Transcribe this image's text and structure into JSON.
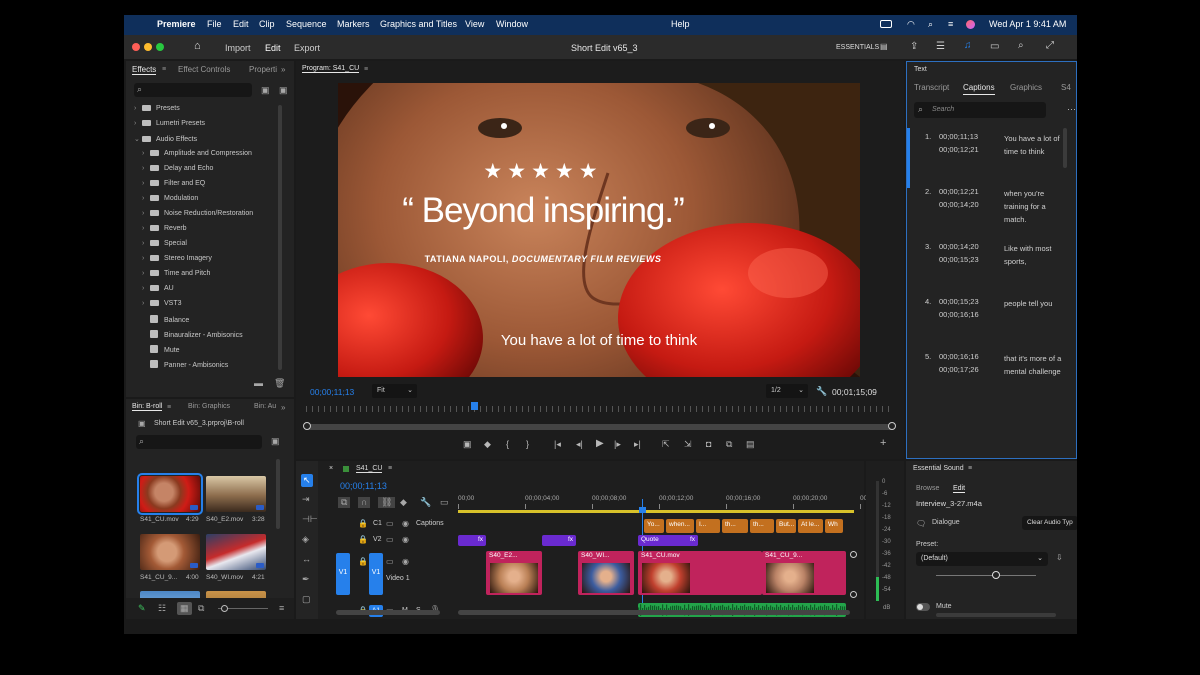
{
  "menubar": {
    "app": "Premiere",
    "items": [
      "File",
      "Edit",
      "Clip",
      "Sequence",
      "Markers",
      "Graphics and Titles",
      "View",
      "Window"
    ],
    "help": "Help",
    "clock": "Wed Apr 1  9:41 AM"
  },
  "titlebar": {
    "nav": [
      "Import",
      "Edit",
      "Export"
    ],
    "active_nav": "Edit",
    "title": "Short Edit v65_3",
    "workspace": "ESSENTIALS"
  },
  "effects_panel": {
    "tabs": [
      "Effects",
      "Effect Controls",
      "Properties"
    ],
    "active_tab": "Effects",
    "tree": [
      {
        "label": "Presets",
        "level": 0,
        "kind": "folder"
      },
      {
        "label": "Lumetri Presets",
        "level": 0,
        "kind": "folder"
      },
      {
        "label": "Audio Effects",
        "level": 0,
        "kind": "folder-open"
      },
      {
        "label": "Amplitude and Compression",
        "level": 1,
        "kind": "folder"
      },
      {
        "label": "Delay and Echo",
        "level": 1,
        "kind": "folder"
      },
      {
        "label": "Filter and EQ",
        "level": 1,
        "kind": "folder"
      },
      {
        "label": "Modulation",
        "level": 1,
        "kind": "folder"
      },
      {
        "label": "Noise Reduction/Restoration",
        "level": 1,
        "kind": "folder"
      },
      {
        "label": "Reverb",
        "level": 1,
        "kind": "folder"
      },
      {
        "label": "Special",
        "level": 1,
        "kind": "folder"
      },
      {
        "label": "Stereo Imagery",
        "level": 1,
        "kind": "folder"
      },
      {
        "label": "Time and Pitch",
        "level": 1,
        "kind": "folder"
      },
      {
        "label": "AU",
        "level": 1,
        "kind": "folder"
      },
      {
        "label": "VST3",
        "level": 1,
        "kind": "folder"
      },
      {
        "label": "Balance",
        "level": 1,
        "kind": "effect"
      },
      {
        "label": "Binauralizer - Ambisonics",
        "level": 1,
        "kind": "effect"
      },
      {
        "label": "Mute",
        "level": 1,
        "kind": "effect"
      },
      {
        "label": "Panner - Ambisonics",
        "level": 1,
        "kind": "effect"
      }
    ]
  },
  "bin_panel": {
    "tabs": [
      "Bin: B-roll",
      "Bin: Graphics",
      "Bin: Au"
    ],
    "active_tab": "Bin: B-roll",
    "path": "Short Edit v65_3.prproj\\B-roll",
    "items": [
      {
        "name": "S41_CU.mov",
        "duration": "4:29",
        "tone": "red"
      },
      {
        "name": "S40_E2.mov",
        "duration": "3:28",
        "tone": "warm"
      },
      {
        "name": "S41_CU_9...",
        "duration": "4:00",
        "tone": "orange"
      },
      {
        "name": "S40_WI.mov",
        "duration": "4:21",
        "tone": "blue"
      },
      {
        "name": "",
        "duration": "",
        "tone": "sky"
      },
      {
        "name": "",
        "duration": "",
        "tone": "sand"
      }
    ]
  },
  "program_monitor": {
    "tab": "Program: S41_CU",
    "stars": "★★★★★",
    "quote": "“ Beyond inspiring.”",
    "attribution": "TATIANA NAPOLI,",
    "attribution_italic": "DOCUMENTARY FILM REVIEWS",
    "caption": "You have a lot of time to think",
    "timecode": "00;00;11;13",
    "zoom": "Fit",
    "resolution": "1/2",
    "duration": "00;01;15;09",
    "playhead_fraction": 0.28
  },
  "text_panel": {
    "title": "Text",
    "tabs": [
      "Transcript",
      "Captions",
      "Graphics",
      "S4"
    ],
    "active_tab": "Captions",
    "search_placeholder": "Search",
    "captions": [
      {
        "num": "1.",
        "in": "00;00;11;13",
        "out": "00;00;12;21",
        "text": "You have a lot of time to think"
      },
      {
        "num": "2.",
        "in": "00;00;12;21",
        "out": "00;00;14;20",
        "text": "when you're training for a match."
      },
      {
        "num": "3.",
        "in": "00;00;14;20",
        "out": "00;00;15;23",
        "text": "Like with most sports,"
      },
      {
        "num": "4.",
        "in": "00;00;15;23",
        "out": "00;00;16;16",
        "text": "people tell you"
      },
      {
        "num": "5.",
        "in": "00;00;16;16",
        "out": "00;00;17;26",
        "text": "that it's more of a mental challenge"
      }
    ]
  },
  "timeline": {
    "sequence": "S41_CU",
    "timecode": "00;00;11;13",
    "ruler": [
      "00;00",
      "00;00;04;00",
      "00;00;08;00",
      "00;00;12;00",
      "00;00;16;00",
      "00;00;20;00",
      "00;0"
    ],
    "tracks": {
      "c1": {
        "id": "C1",
        "name": "Captions"
      },
      "v2": {
        "id": "V2"
      },
      "v1": {
        "id": "V1",
        "source": "V1",
        "name": "Video 1"
      },
      "a1": {
        "id": "A1",
        "source": "A1",
        "m": "M",
        "s": "S"
      }
    },
    "caption_clips": [
      "Yo...",
      "when...",
      "I...",
      "th...",
      "th...",
      "But...",
      "At le...",
      "Wh"
    ],
    "v2_clips": [
      "fx",
      "fx",
      "Quote",
      "fx"
    ],
    "v1_clips": [
      "S40_E2...",
      "S40_WI...",
      "S41_CU.mov",
      "S41_CU_9..."
    ],
    "meter_ticks": [
      "0",
      "-6",
      "-12",
      "-18",
      "-24",
      "-30",
      "-36",
      "-42",
      "-48",
      "-54"
    ],
    "meter_unit": "dB"
  },
  "essential_sound": {
    "title": "Essential Sound",
    "tabs": [
      "Browse",
      "Edit"
    ],
    "active_tab": "Edit",
    "clip": "Interview_3-27.m4a",
    "type": "Dialogue",
    "clear_button": "Clear Audio Typ",
    "preset_label": "Preset:",
    "preset_value": "(Default)",
    "mute_label": "Mute",
    "slider_fraction": 0.6
  },
  "colors": {
    "accent_blue": "#2680eb",
    "menubar": "#0f2f5b",
    "caption_clip": "#c3701f",
    "fx_clip": "#6a2ad0",
    "video_clip": "#c0235c",
    "audio_clip": "#23a44a"
  }
}
